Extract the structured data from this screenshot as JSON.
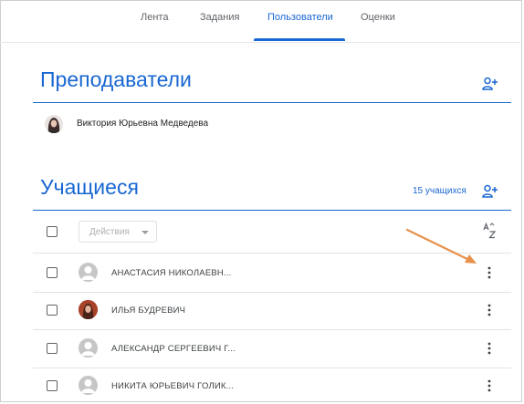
{
  "tabs": [
    {
      "label": "Лента",
      "active": false
    },
    {
      "label": "Задания",
      "active": false
    },
    {
      "label": "Пользователи",
      "active": true
    },
    {
      "label": "Оценки",
      "active": false
    }
  ],
  "teachers": {
    "title": "Преподаватели",
    "items": [
      {
        "name": "Виктория Юрьевна Медведева"
      }
    ]
  },
  "students": {
    "title": "Учащиеся",
    "count_label": "15 учащихся",
    "actions_label": "Действия",
    "items": [
      {
        "name": "АНАСТАСИЯ НИКОЛАЕВН...",
        "avatar": "default"
      },
      {
        "name": "ИЛЬЯ БУДРЕВИЧ",
        "avatar": "photo"
      },
      {
        "name": "АЛЕКСАНДР СЕРГЕЕВИЧ Г...",
        "avatar": "default"
      },
      {
        "name": "НИКИТА ЮРЬЕВИЧ ГОЛИК...",
        "avatar": "default"
      }
    ]
  },
  "colors": {
    "accent": "#1967d2",
    "annotation_arrow": "#e8914a"
  },
  "icons": [
    "add-person-icon",
    "sort-az-icon",
    "more-vert-icon",
    "default-avatar-icon",
    "dropdown-caret-icon",
    "annotation-arrow"
  ]
}
